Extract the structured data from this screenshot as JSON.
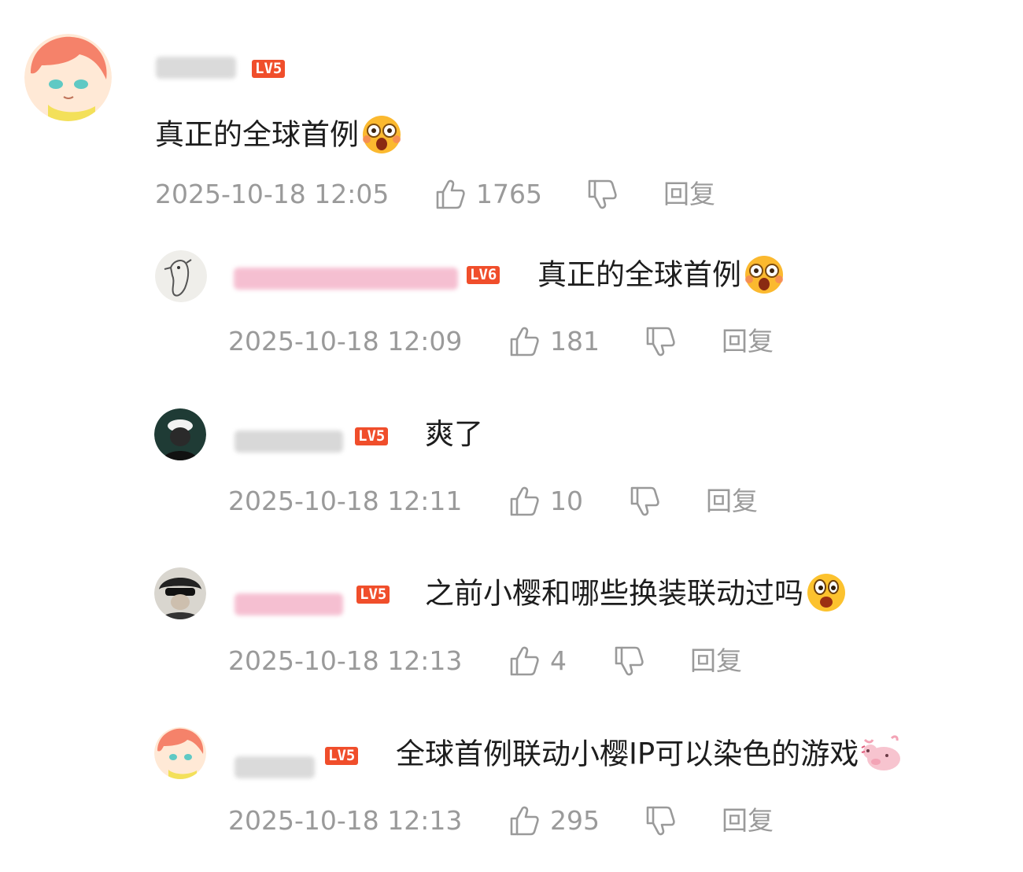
{
  "colors": {
    "level_badge_bg": "#f04e2b",
    "meta_text": "#9a9a9a",
    "comment_text": "#1d1d1d",
    "username_blur": "#d8d8d8",
    "username_blur_pink": "#f5b9cd"
  },
  "icons": {
    "like": "thumbs-up-icon",
    "dislike": "thumbs-down-icon",
    "emoji_shock": "shocked-face-emoji",
    "emoji_surprise": "surprised-face-emoji",
    "emoji_pig": "pig-emoji"
  },
  "comments": [
    {
      "level": "LV5",
      "text": "真正的全球首例",
      "emoji": "shocked-face-emoji",
      "timestamp": "2025-10-18 12:05",
      "likes": "1765",
      "reply_label": "回复"
    }
  ],
  "replies": [
    {
      "level": "LV6",
      "text": "真正的全球首例",
      "emoji": "shocked-face-emoji",
      "timestamp": "2025-10-18 12:09",
      "likes": "181",
      "reply_label": "回复"
    },
    {
      "level": "LV5",
      "text": "爽了",
      "emoji": "",
      "timestamp": "2025-10-18 12:11",
      "likes": "10",
      "reply_label": "回复"
    },
    {
      "level": "LV5",
      "text": "之前小樱和哪些换装联动过吗",
      "emoji": "surprised-face-emoji",
      "timestamp": "2025-10-18 12:13",
      "likes": "4",
      "reply_label": "回复"
    },
    {
      "level": "LV5",
      "text": "全球首例联动小樱IP可以染色的游戏",
      "emoji": "pig-emoji",
      "timestamp": "2025-10-18 12:13",
      "likes": "295",
      "reply_label": "回复"
    }
  ]
}
